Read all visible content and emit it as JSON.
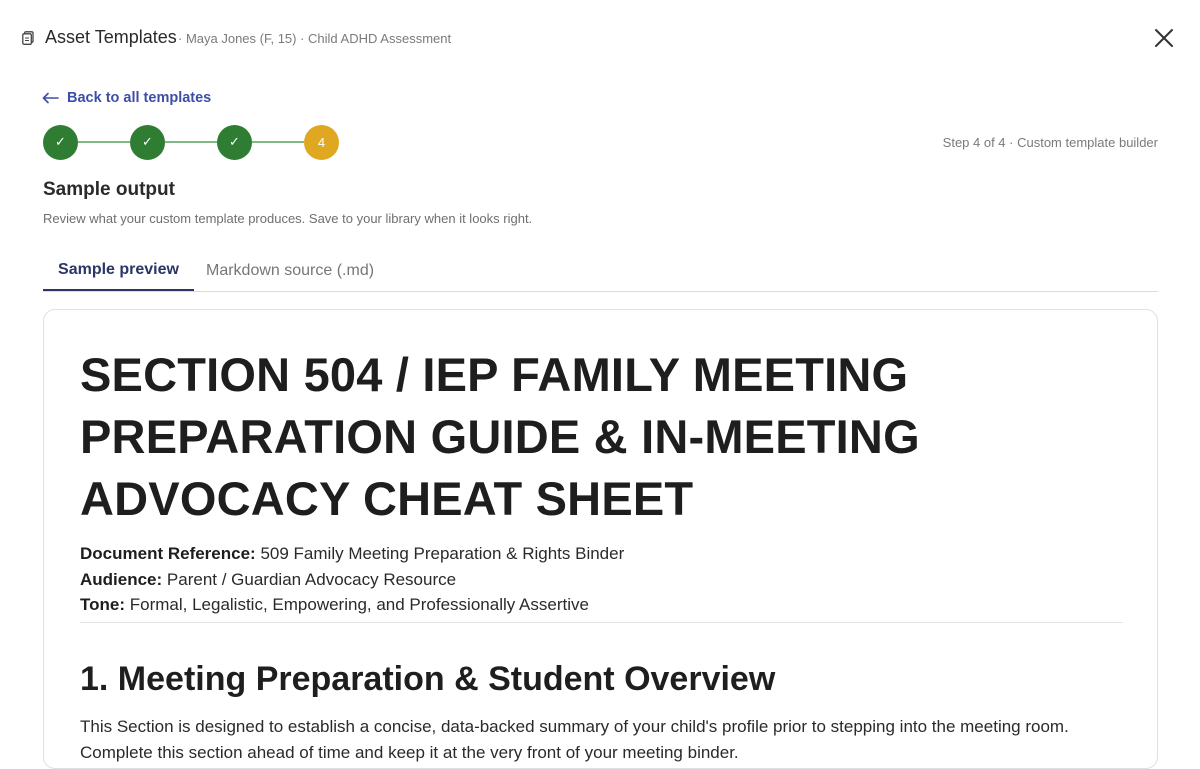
{
  "header": {
    "title": "Asset Templates",
    "subtitle": "· Maya Jones (F, 15) · Child ADHD Assessment",
    "icon": "document-icon",
    "close_icon": "close-icon"
  },
  "back_link": {
    "label": "Back to all templates",
    "icon": "arrow-left-icon"
  },
  "stepper": {
    "steps": [
      {
        "label": "✓",
        "state": "complete"
      },
      {
        "label": "✓",
        "state": "complete"
      },
      {
        "label": "✓",
        "state": "complete"
      },
      {
        "label": "4",
        "state": "current"
      }
    ],
    "caption": "Step 4 of 4 · Custom template builder",
    "colors": {
      "complete": "#2e7d32",
      "current": "#e0a820"
    }
  },
  "section": {
    "title": "Sample output",
    "description": "Review what your custom template produces. Save to your library when it looks right."
  },
  "tabs": [
    {
      "label": "Sample preview",
      "active": true
    },
    {
      "label": "Markdown source (.md)",
      "active": false
    }
  ],
  "document": {
    "title": "SECTION 504 / IEP FAMILY MEETING PREPARATION GUIDE & IN-MEETING ADVOCACY CHEAT SHEET",
    "meta": [
      {
        "label": "Document Reference:",
        "value": "509 Family Meeting Preparation & Rights Binder"
      },
      {
        "label": "Audience:",
        "value": "Parent / Guardian Advocacy Resource"
      },
      {
        "label": "Tone:",
        "value": "Formal, Legalistic, Empowering, and Professionally Assertive"
      }
    ],
    "section_heading": "1. Meeting Preparation & Student Overview",
    "paragraph": "This Section is designed to establish a concise, data-backed summary of your child's profile prior to stepping into the meeting room. Complete this section ahead of time and keep it at the very front of your meeting binder."
  }
}
